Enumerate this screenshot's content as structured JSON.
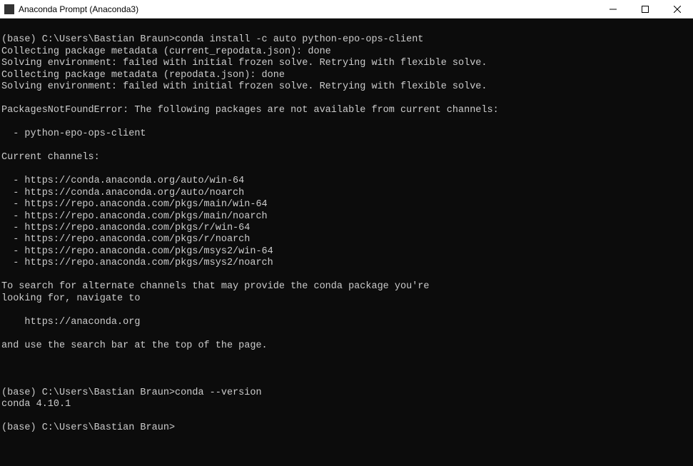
{
  "titlebar": {
    "title": "Anaconda Prompt (Anaconda3)"
  },
  "terminal": {
    "lines": [
      "(base) C:\\Users\\Bastian Braun>conda install -c auto python-epo-ops-client",
      "Collecting package metadata (current_repodata.json): done",
      "Solving environment: failed with initial frozen solve. Retrying with flexible solve.",
      "Collecting package metadata (repodata.json): done",
      "Solving environment: failed with initial frozen solve. Retrying with flexible solve.",
      "",
      "PackagesNotFoundError: The following packages are not available from current channels:",
      "",
      "  - python-epo-ops-client",
      "",
      "Current channels:",
      "",
      "  - https://conda.anaconda.org/auto/win-64",
      "  - https://conda.anaconda.org/auto/noarch",
      "  - https://repo.anaconda.com/pkgs/main/win-64",
      "  - https://repo.anaconda.com/pkgs/main/noarch",
      "  - https://repo.anaconda.com/pkgs/r/win-64",
      "  - https://repo.anaconda.com/pkgs/r/noarch",
      "  - https://repo.anaconda.com/pkgs/msys2/win-64",
      "  - https://repo.anaconda.com/pkgs/msys2/noarch",
      "",
      "To search for alternate channels that may provide the conda package you're",
      "looking for, navigate to",
      "",
      "    https://anaconda.org",
      "",
      "and use the search bar at the top of the page.",
      "",
      "",
      "",
      "(base) C:\\Users\\Bastian Braun>conda --version",
      "conda 4.10.1",
      "",
      "(base) C:\\Users\\Bastian Braun>"
    ]
  }
}
